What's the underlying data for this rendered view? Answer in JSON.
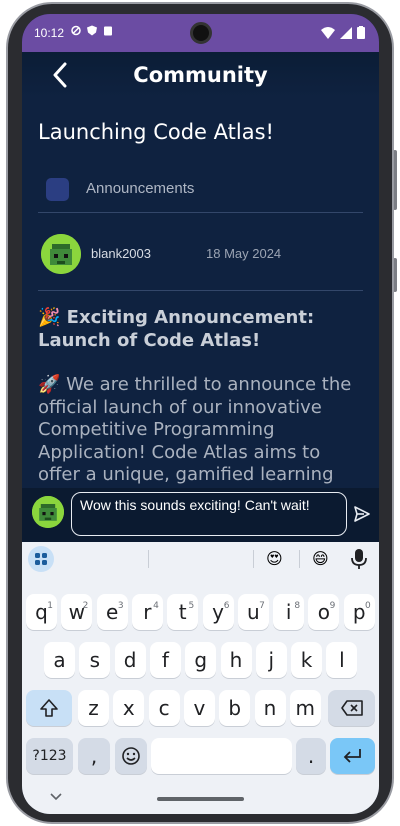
{
  "status": {
    "time": "10:12"
  },
  "app": {
    "title": "Community"
  },
  "post": {
    "title": "Launching Code Atlas!",
    "category": "Announcements",
    "author": "blank2003",
    "date": "18 May 2024",
    "heading": "🎉 Exciting Announcement: Launch of Code Atlas!",
    "body": "🚀  We are thrilled to announce the official launch of our innovative Competitive Programming Application! Code Atlas aims to offer a unique, gamified learning"
  },
  "comment": {
    "text": "Wow this sounds exciting! Can't wait!"
  },
  "keyboard": {
    "row1": [
      {
        "k": "q",
        "h": "1"
      },
      {
        "k": "w",
        "h": "2"
      },
      {
        "k": "e",
        "h": "3"
      },
      {
        "k": "r",
        "h": "4"
      },
      {
        "k": "t",
        "h": "5"
      },
      {
        "k": "y",
        "h": "6"
      },
      {
        "k": "u",
        "h": "7"
      },
      {
        "k": "i",
        "h": "8"
      },
      {
        "k": "o",
        "h": "9"
      },
      {
        "k": "p",
        "h": "0"
      }
    ],
    "row2": [
      "a",
      "s",
      "d",
      "f",
      "g",
      "h",
      "j",
      "k",
      "l"
    ],
    "row3": [
      "z",
      "x",
      "c",
      "v",
      "b",
      "n",
      "m"
    ],
    "symbols": "?123",
    "comma": ",",
    "period": ".",
    "emoji1": "😍",
    "emoji2": "😄"
  },
  "colors": {
    "accent": "#6b4ca3",
    "background": "#0f2240",
    "keyboard": "#eef1f6"
  }
}
